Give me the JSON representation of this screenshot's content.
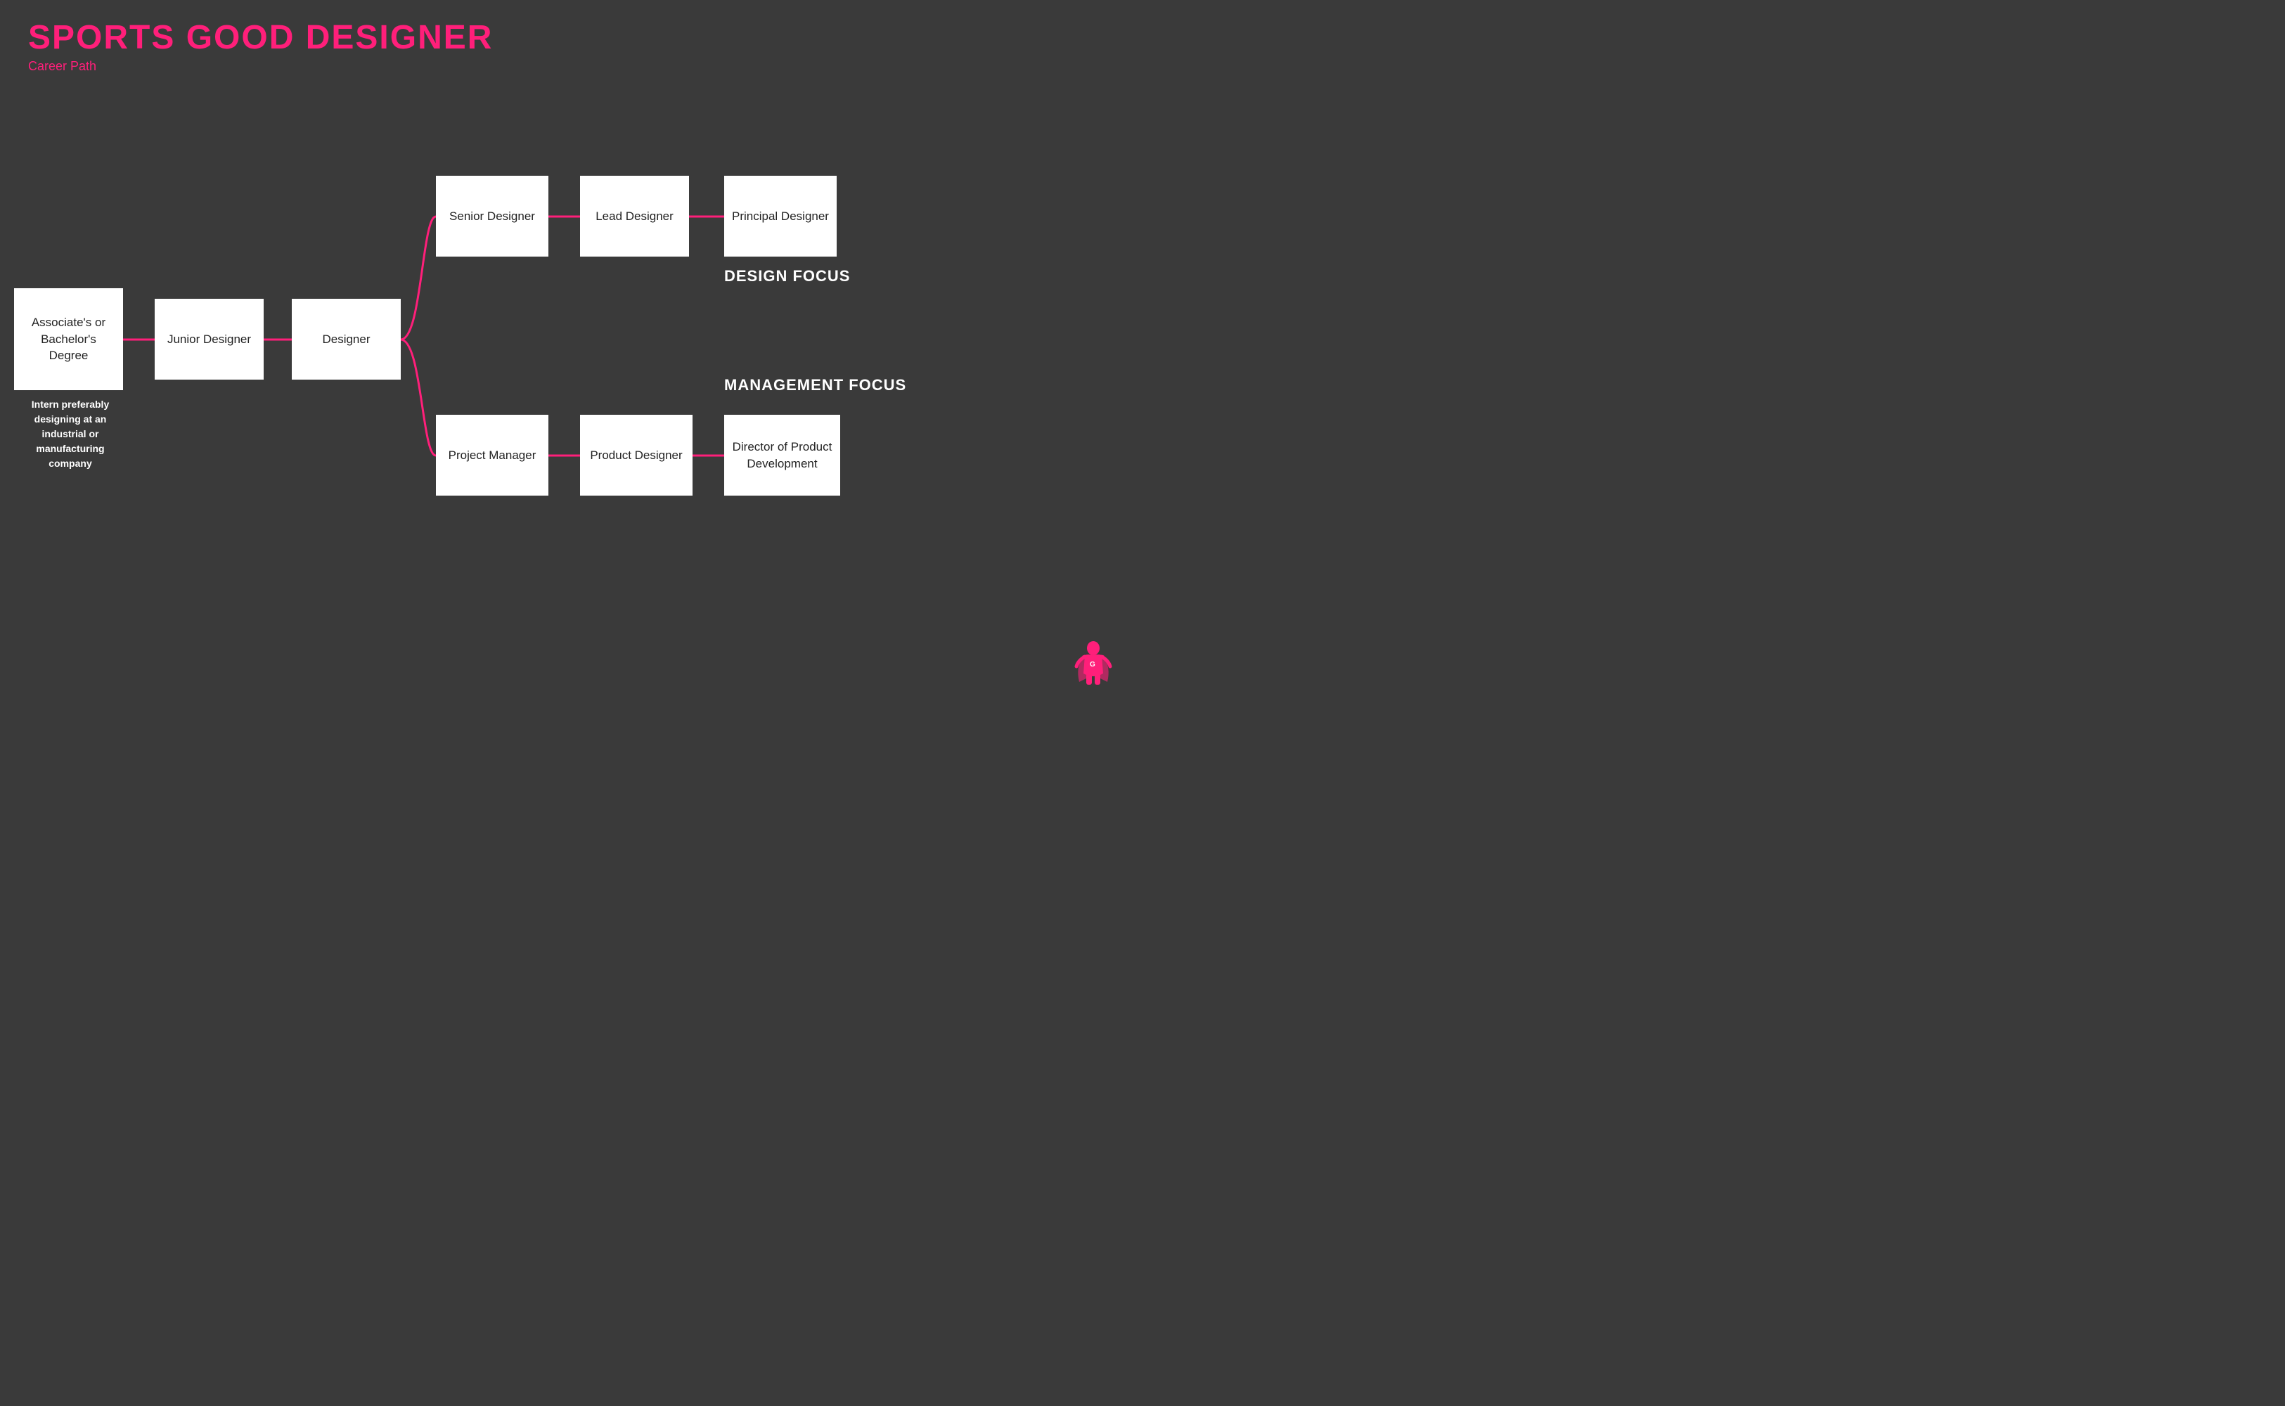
{
  "header": {
    "main_title": "SPORTS GOOD DESIGNER",
    "subtitle": "Career Path"
  },
  "boxes": {
    "degree": "Associate's or Bachelor's Degree",
    "junior": "Junior Designer",
    "designer": "Designer",
    "senior": "Senior Designer",
    "lead": "Lead Designer",
    "principal": "Principal Designer",
    "pm": "Project Manager",
    "product_designer": "Product Designer",
    "director": "Director of Product Development"
  },
  "labels": {
    "intern_text": "Intern preferably designing at an industrial or manufacturing company",
    "design_focus": "DESIGN FOCUS",
    "management_focus": "MANAGEMENT FOCUS"
  },
  "colors": {
    "accent": "#ff1f7a",
    "background": "#3a3a3a",
    "box_bg": "#ffffff",
    "text_dark": "#222222",
    "text_white": "#ffffff"
  }
}
